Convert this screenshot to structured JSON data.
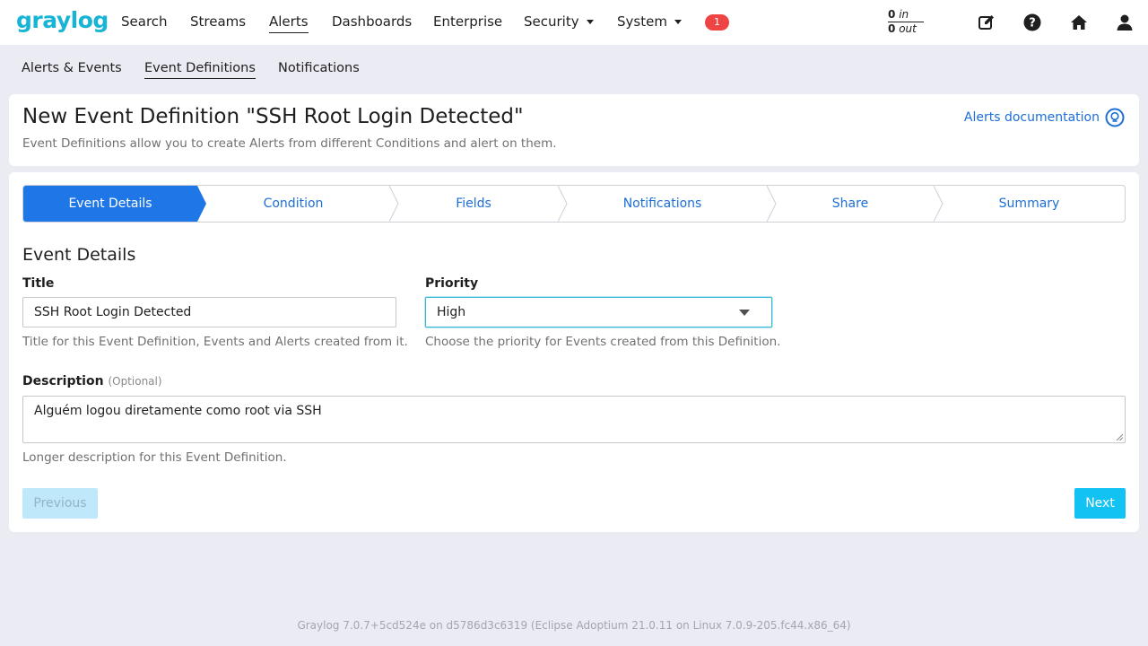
{
  "brand": {
    "logo_text": "graylog"
  },
  "nav": {
    "items": [
      {
        "label": "Search"
      },
      {
        "label": "Streams"
      },
      {
        "label": "Alerts"
      },
      {
        "label": "Dashboards"
      },
      {
        "label": "Enterprise"
      },
      {
        "label": "Security"
      },
      {
        "label": "System"
      }
    ],
    "notification_count": "1",
    "throughput": {
      "in_value": "0",
      "in_label": "in",
      "out_value": "0",
      "out_label": "out"
    },
    "icons": [
      "edit-icon",
      "help-icon",
      "home-icon",
      "user-icon"
    ]
  },
  "subnav": {
    "items": [
      {
        "label": "Alerts & Events"
      },
      {
        "label": "Event Definitions"
      },
      {
        "label": "Notifications"
      }
    ]
  },
  "header": {
    "title": "New Event Definition \"SSH Root Login Detected\"",
    "subtitle": "Event Definitions allow you to create Alerts from different Conditions and alert on them.",
    "docs_link": "Alerts documentation"
  },
  "wizard": {
    "steps": [
      {
        "label": "Event Details"
      },
      {
        "label": "Condition"
      },
      {
        "label": "Fields"
      },
      {
        "label": "Notifications"
      },
      {
        "label": "Share"
      },
      {
        "label": "Summary"
      }
    ],
    "active_step": "Event Details"
  },
  "form": {
    "section_title": "Event Details",
    "title_label": "Title",
    "title_value": "SSH Root Login Detected",
    "title_help": "Title for this Event Definition, Events and Alerts created from it.",
    "priority_label": "Priority",
    "priority_value": "High",
    "priority_help": "Choose the priority for Events created from this Definition.",
    "description_label": "Description",
    "description_optional": "(Optional)",
    "description_value": "Alguém logou diretamente como root via SSH",
    "description_help": "Longer description for this Event Definition."
  },
  "buttons": {
    "previous": "Previous",
    "next": "Next"
  },
  "footer": {
    "text": "Graylog 7.0.7+5cd524e on d5786d3c6319 (Eclipse Adoptium 21.0.11 on Linux 7.0.9-205.fc44.x86_64)"
  },
  "colors": {
    "brand": "#18b4d6",
    "primary": "#1f76e6",
    "link": "#1c6fd6",
    "next_button": "#12c2f3",
    "badge": "#ef4444"
  }
}
